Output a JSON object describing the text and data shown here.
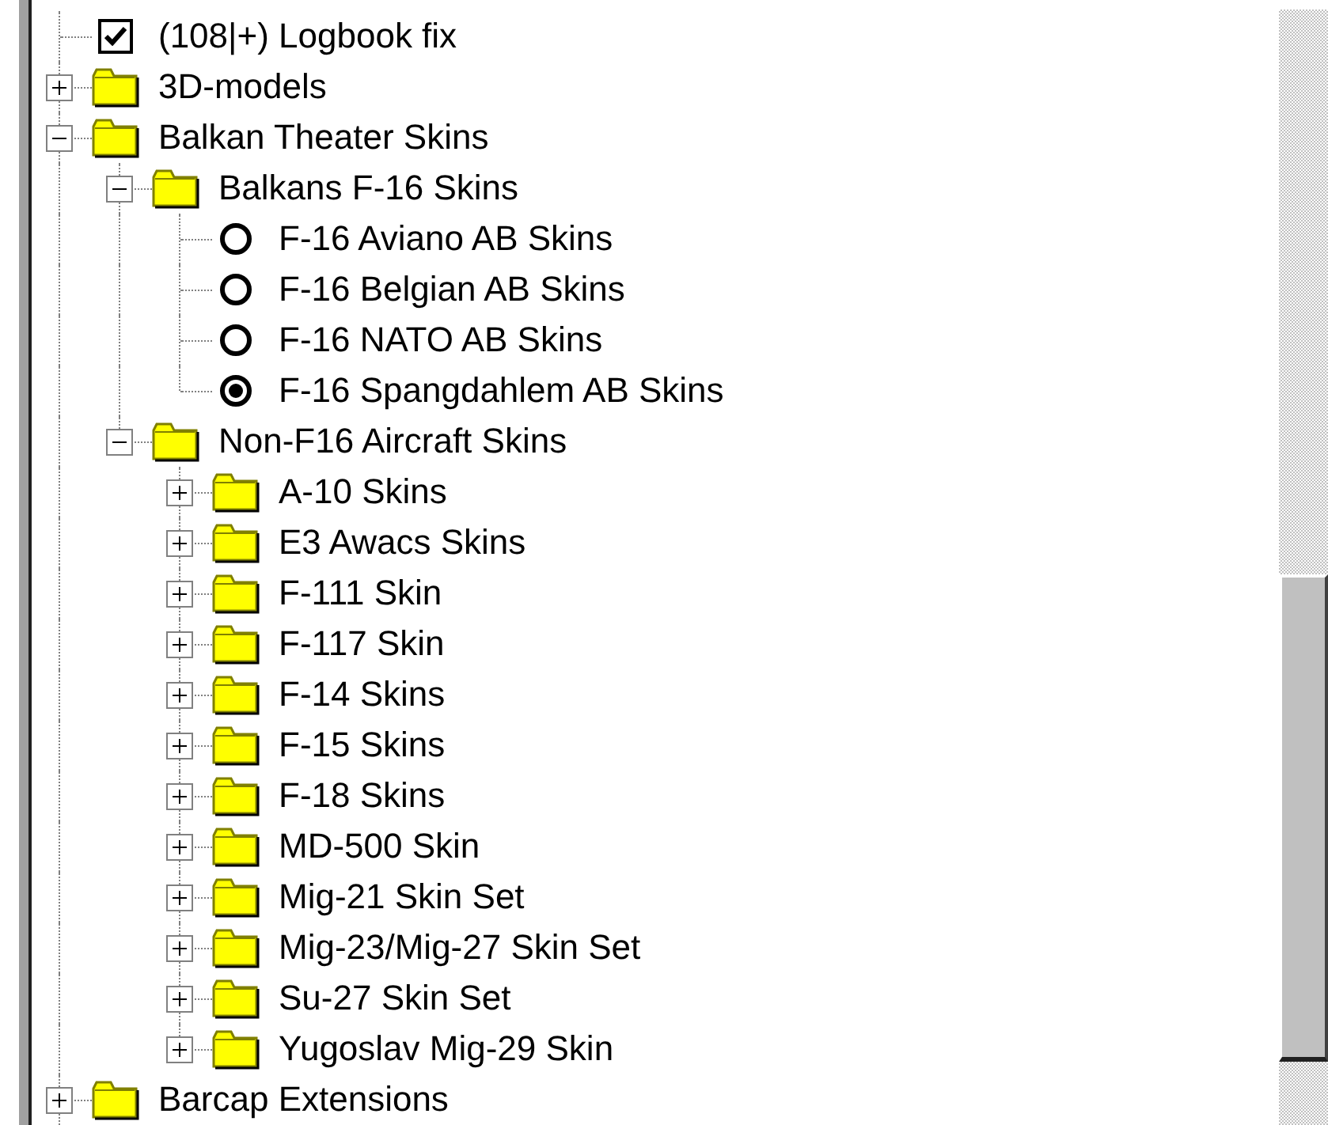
{
  "tree": [
    {
      "kind": "checkbox",
      "label": "(108|+) Logbook fix",
      "checked": true
    },
    {
      "kind": "folder",
      "label": "3D-models",
      "expanded": false
    },
    {
      "kind": "folder",
      "label": "Balkan Theater Skins",
      "expanded": true,
      "children": [
        {
          "kind": "folder",
          "label": "Balkans F-16 Skins",
          "expanded": true,
          "children": [
            {
              "kind": "radio",
              "label": "F-16 Aviano AB Skins",
              "selected": false
            },
            {
              "kind": "radio",
              "label": "F-16 Belgian AB Skins",
              "selected": false
            },
            {
              "kind": "radio",
              "label": "F-16 NATO AB Skins",
              "selected": false
            },
            {
              "kind": "radio",
              "label": "F-16 Spangdahlem AB Skins",
              "selected": true
            }
          ]
        },
        {
          "kind": "folder",
          "label": "Non-F16 Aircraft Skins",
          "expanded": true,
          "children": [
            {
              "kind": "folder",
              "label": "A-10 Skins",
              "expanded": false
            },
            {
              "kind": "folder",
              "label": "E3 Awacs Skins",
              "expanded": false
            },
            {
              "kind": "folder",
              "label": "F-111 Skin",
              "expanded": false
            },
            {
              "kind": "folder",
              "label": "F-117 Skin",
              "expanded": false
            },
            {
              "kind": "folder",
              "label": "F-14 Skins",
              "expanded": false
            },
            {
              "kind": "folder",
              "label": "F-15 Skins",
              "expanded": false
            },
            {
              "kind": "folder",
              "label": "F-18 Skins",
              "expanded": false
            },
            {
              "kind": "folder",
              "label": "MD-500 Skin",
              "expanded": false
            },
            {
              "kind": "folder",
              "label": "Mig-21 Skin Set",
              "expanded": false
            },
            {
              "kind": "folder",
              "label": "Mig-23/Mig-27 Skin Set",
              "expanded": false
            },
            {
              "kind": "folder",
              "label": "Su-27 Skin Set",
              "expanded": false
            },
            {
              "kind": "folder",
              "label": "Yugoslav Mig-29 Skin",
              "expanded": false
            }
          ]
        }
      ]
    },
    {
      "kind": "folder",
      "label": "Barcap Extensions",
      "expanded": false
    }
  ]
}
